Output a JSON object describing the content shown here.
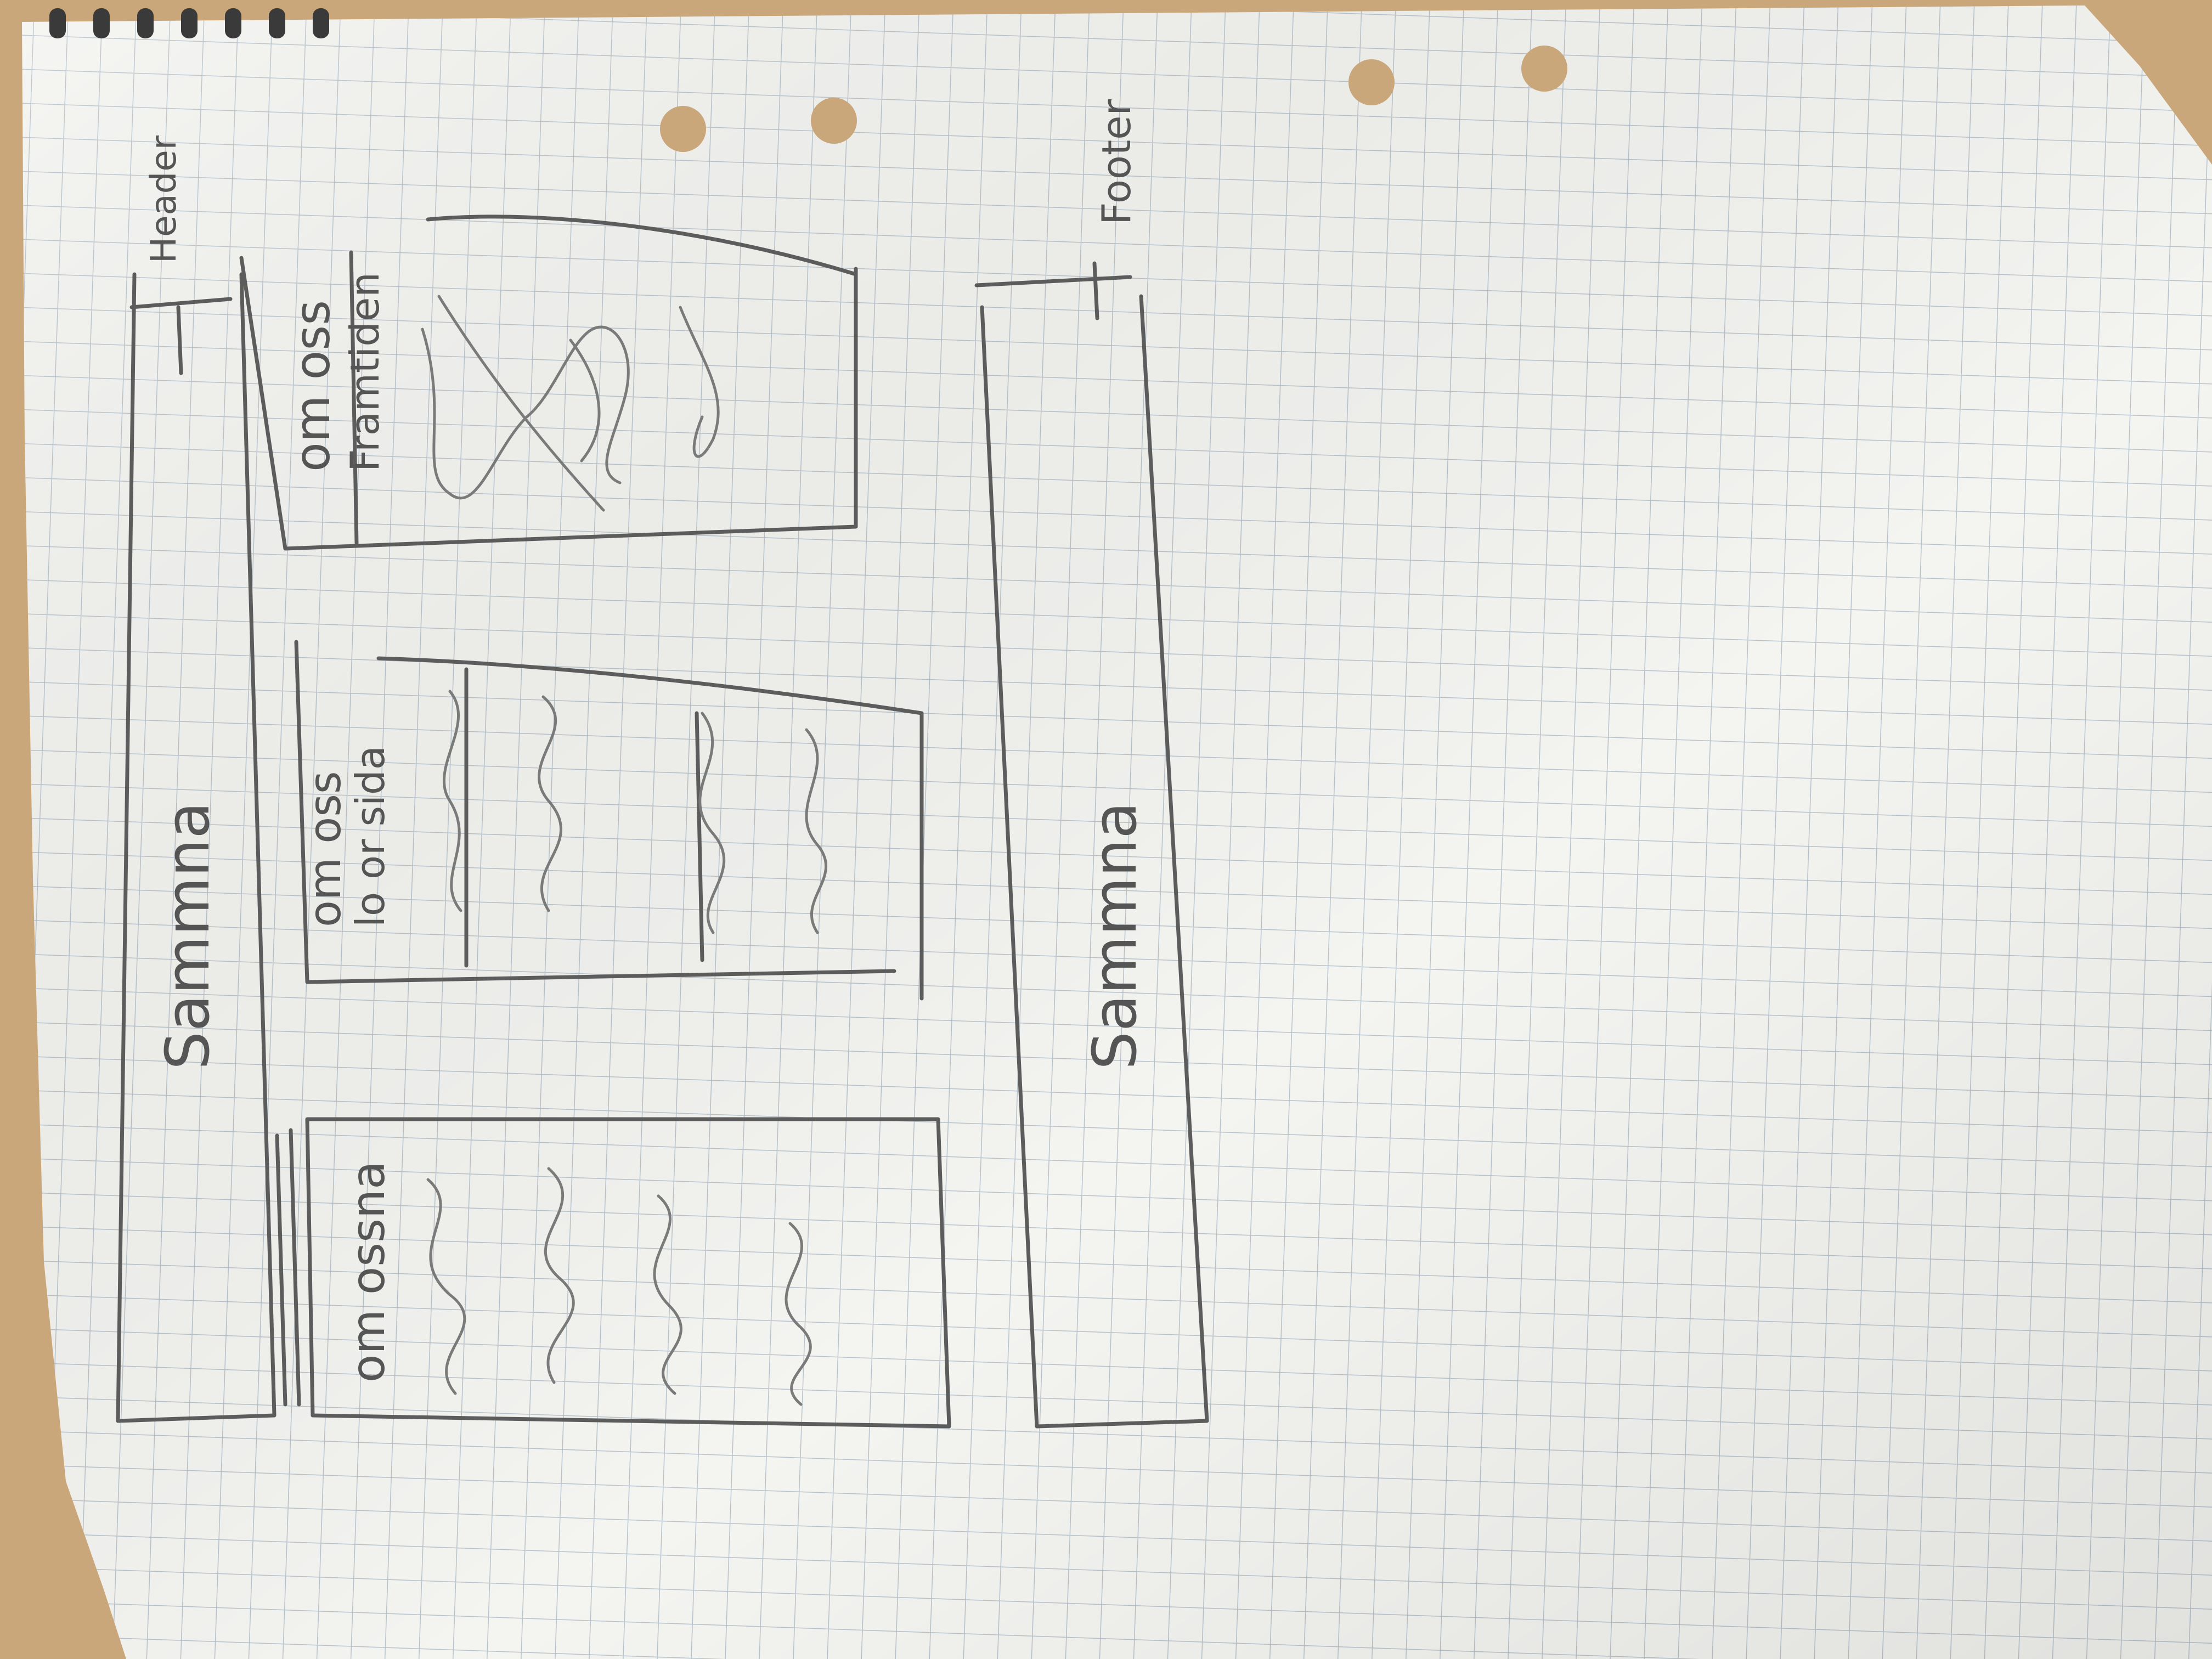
{
  "sketch": {
    "labels": {
      "header": "Header",
      "footer": "Footer",
      "header_box": "Sammna",
      "footer_box": "Sammna",
      "card_left": "om ossna",
      "card_middle_title": "om oss",
      "card_middle_sub": "lo or sida",
      "card_right_title": "om oss",
      "card_right_sub": "Framtiden"
    },
    "colors": {
      "table": "#c9a77a",
      "paper": "#f4f4f1",
      "grid": "#b9c3cc",
      "pencil": "#5c5c5c"
    }
  }
}
